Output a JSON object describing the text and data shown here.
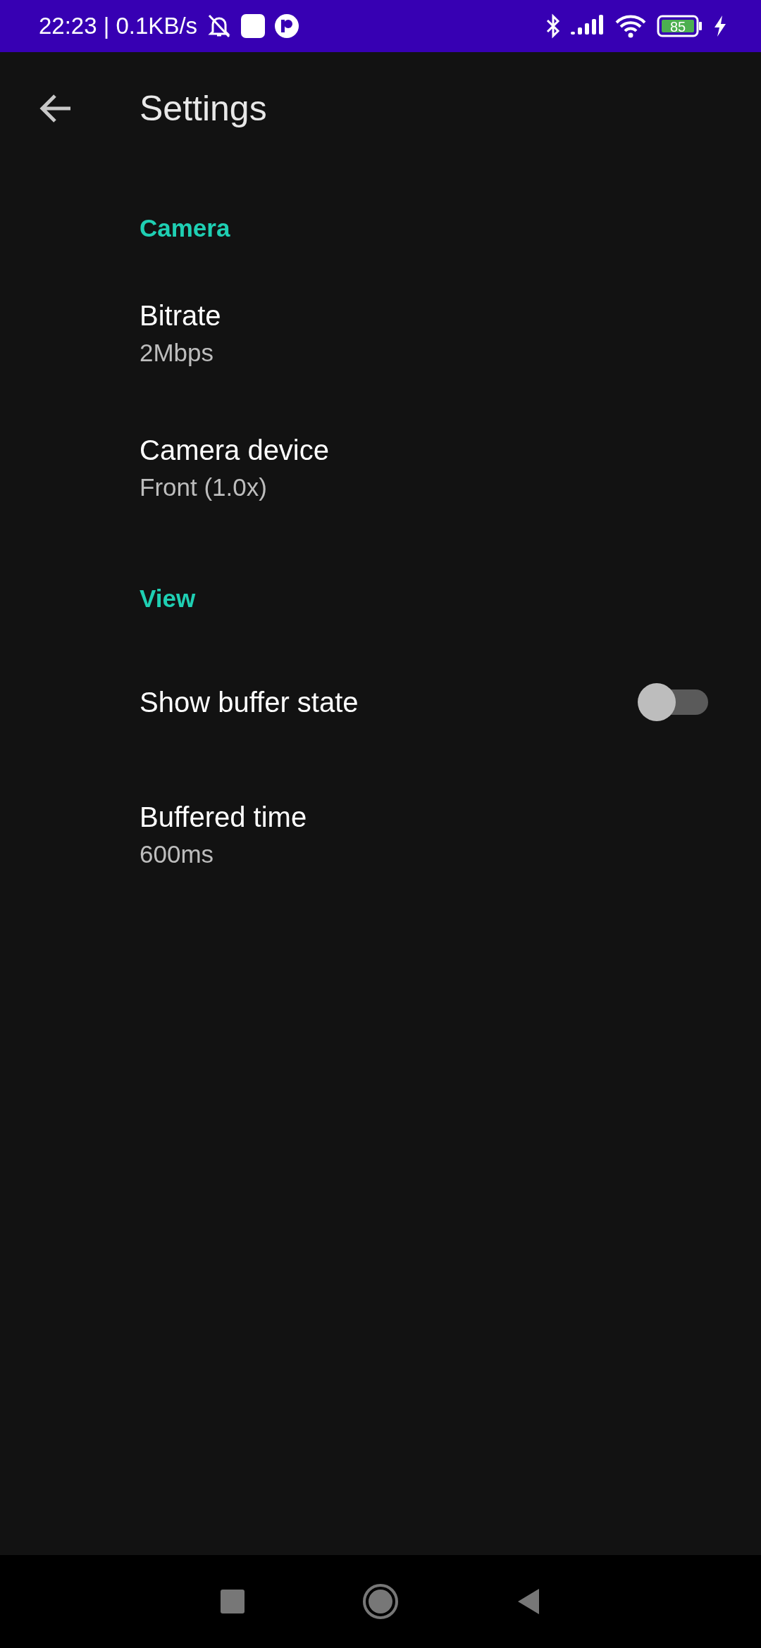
{
  "status_bar": {
    "time": "22:23 | 0.1KB/s",
    "battery": "85"
  },
  "app_bar": {
    "title": "Settings"
  },
  "sections": [
    {
      "title": "Camera",
      "items": [
        {
          "kind": "text",
          "title": "Bitrate",
          "summary": "2Mbps"
        },
        {
          "kind": "text",
          "title": "Camera device",
          "summary": "Front (1.0x)"
        }
      ]
    },
    {
      "title": "View",
      "items": [
        {
          "kind": "switch",
          "title": "Show buffer state",
          "on": false
        },
        {
          "kind": "text",
          "title": "Buffered time",
          "summary": "600ms"
        }
      ]
    }
  ]
}
